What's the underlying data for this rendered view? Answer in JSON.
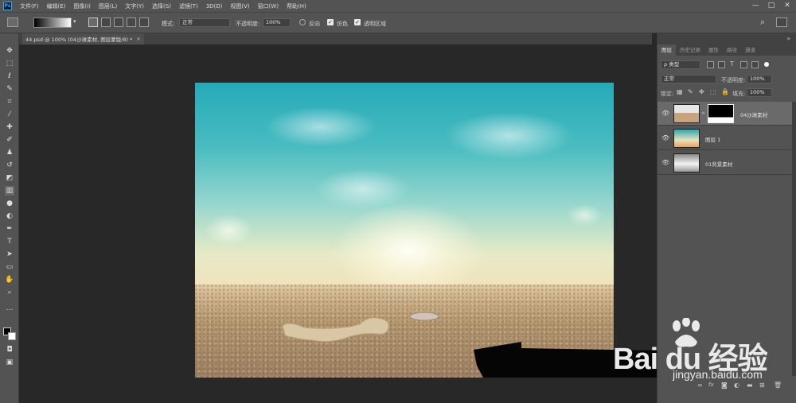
{
  "menubar": {
    "logo": "Ps",
    "items": [
      "文件(F)",
      "编辑(E)",
      "图像(I)",
      "图层(L)",
      "文字(Y)",
      "选择(S)",
      "滤镜(T)",
      "3D(D)",
      "视图(V)",
      "窗口(W)",
      "帮助(H)"
    ],
    "window_controls": [
      "—",
      "□",
      "✕"
    ]
  },
  "options": {
    "mode_label": "模式:",
    "mode_value": "正常",
    "opacity_label": "不透明度:",
    "opacity_value": "100%",
    "reverse_label": "反向",
    "dither_label": "仿色",
    "transparency_label": "透明区域",
    "dither_checked": true,
    "transparency_checked": true,
    "reverse_checked": false
  },
  "document": {
    "tab_title": "44.psd @ 100% (04沙滩素材, 图层蒙版/8) *",
    "close": "×"
  },
  "layers_panel": {
    "tabs": [
      "图层",
      "历史记录",
      "属性",
      "路径",
      "通道"
    ],
    "filter_value": "ρ 类型",
    "blend_value": "正常",
    "opacity_label": "不透明度:",
    "opacity_value": "100%",
    "lock_label": "锁定:",
    "fill_label": "填充:",
    "fill_value": "100%",
    "layers": [
      {
        "name": "04沙滩素材",
        "selected": true
      },
      {
        "name": "图层 1",
        "selected": false
      },
      {
        "name": "01背景素材",
        "selected": false
      }
    ],
    "footer_icons": [
      "link-icon",
      "fx-icon",
      "mask-icon",
      "adjustment-icon",
      "folder-icon",
      "new-layer-icon",
      "trash-icon"
    ]
  },
  "watermark": {
    "top": "Bai du 经验",
    "url": "jingyan.baidu.com"
  },
  "colors": {
    "accent": "#31a8ff",
    "ui_bg": "#535353",
    "canvas_bg": "#282828"
  }
}
